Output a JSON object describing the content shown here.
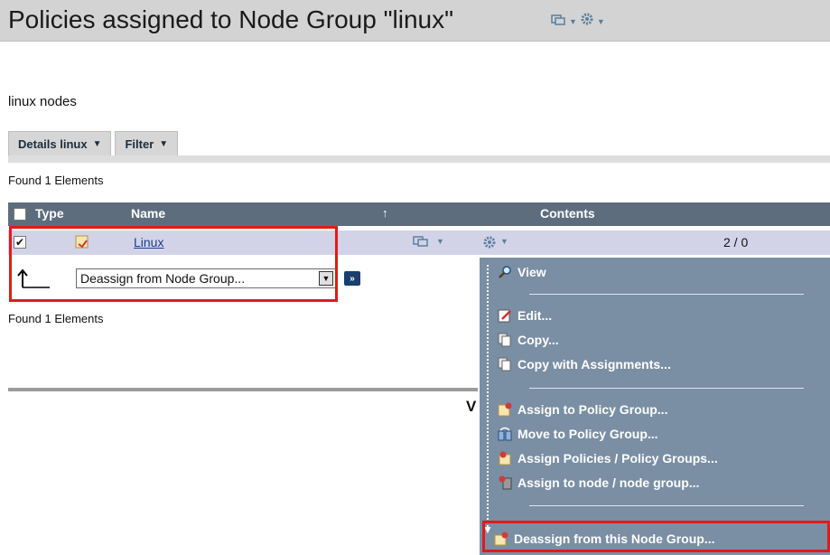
{
  "title": "Policies assigned to Node Group \"linux\"",
  "subtitle": "linux nodes",
  "tabs": [
    {
      "label": "Details linux"
    },
    {
      "label": "Filter"
    }
  ],
  "found_top": "Found 1 Elements",
  "found_bottom": "Found 1 Elements",
  "table": {
    "columns": {
      "type": "Type",
      "name": "Name",
      "contents": "Contents"
    },
    "rows": [
      {
        "checked": true,
        "name": "Linux",
        "count": "2 / 0"
      }
    ]
  },
  "action": {
    "select_value": "Deassign from Node Group...",
    "go_label": "»"
  },
  "partial_text": "V",
  "context_menu": {
    "items": [
      {
        "label": "View",
        "icon": "magnifier-icon"
      },
      {
        "label": "Edit...",
        "icon": "edit-icon"
      },
      {
        "label": "Copy...",
        "icon": "copy-icon"
      },
      {
        "label": "Copy with Assignments...",
        "icon": "copy-icon"
      },
      {
        "label": "Assign to Policy Group...",
        "icon": "assign-icon"
      },
      {
        "label": "Move to Policy Group...",
        "icon": "move-icon"
      },
      {
        "label": "Assign Policies / Policy Groups...",
        "icon": "assign-policies-icon"
      },
      {
        "label": "Assign to node / node group...",
        "icon": "node-assign-icon"
      },
      {
        "label": "Deassign from this Node Group...",
        "icon": "deassign-icon"
      }
    ]
  },
  "colors": {
    "title_bg": "#d3d3d3",
    "header_bg": "#5d6d7e",
    "row_bg": "#d3d3e8",
    "menu_bg": "#7a8ea4",
    "highlight": "#e01b1b"
  }
}
